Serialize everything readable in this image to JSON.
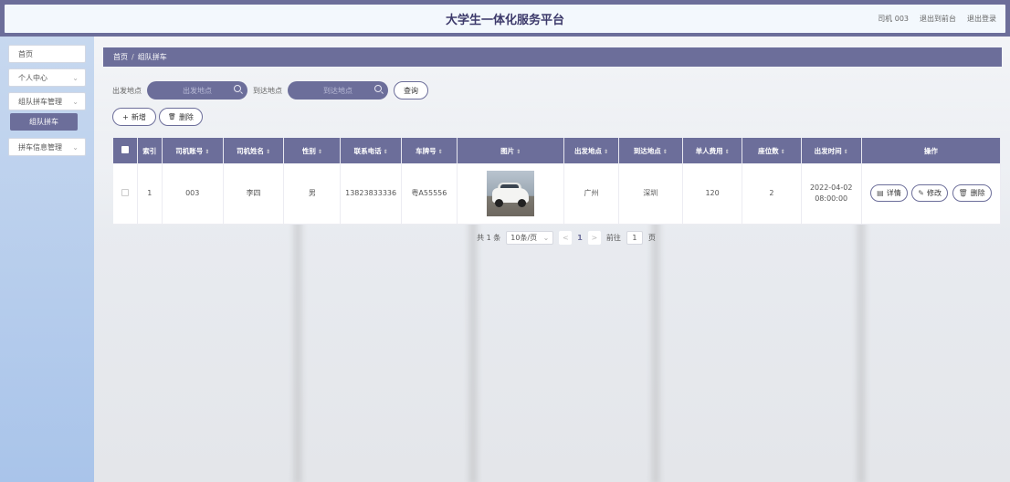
{
  "app": {
    "title": "大学生一体化服务平台"
  },
  "header": {
    "user": "司机 003",
    "go_front": "退出到前台",
    "logout": "退出登录"
  },
  "sidebar": {
    "items": [
      {
        "label": "首页",
        "has_chevron": false
      },
      {
        "label": "个人中心",
        "has_chevron": true
      },
      {
        "label": "组队拼车管理",
        "has_chevron": true
      },
      {
        "label": "拼车信息管理",
        "has_chevron": true
      }
    ],
    "active_sub": "组队拼车",
    "chevron": "⌄"
  },
  "breadcrumb": {
    "home": "首页",
    "sep": "/",
    "current": "组队拼车"
  },
  "search": {
    "origin_label": "出发地点",
    "origin_placeholder": "出发地点",
    "dest_label": "到达地点",
    "dest_placeholder": "到达地点",
    "query_button": "查询"
  },
  "actions": {
    "add": "新增",
    "delete": "删除",
    "add_icon": "+",
    "delete_icon": "🗑"
  },
  "table": {
    "columns": [
      "索引",
      "司机账号",
      "司机姓名",
      "性别",
      "联系电话",
      "车牌号",
      "图片",
      "出发地点",
      "到达地点",
      "单人费用",
      "座位数",
      "出发时间",
      "操作"
    ],
    "sort_glyph": "⇕",
    "rows": [
      {
        "index": "1",
        "driver_account": "003",
        "driver_name": "李四",
        "gender": "男",
        "phone": "13823833336",
        "plate": "粤A55556",
        "image": "white-suv-photo",
        "origin": "广州",
        "destination": "深圳",
        "fee": "120",
        "seats": "2",
        "depart_time": "2022-04-02 08:00:00"
      }
    ],
    "ops": {
      "detail": "详情",
      "edit": "修改",
      "delete": "删除"
    }
  },
  "pagination": {
    "total": "共 1 条",
    "page_size": "10条/页",
    "prev": "<",
    "current_page": "1",
    "next": ">",
    "goto_label": "前往",
    "goto_value": "1",
    "page_unit": "页"
  },
  "colors": {
    "primary": "#6c6e9a",
    "header_bg": "#f3f8fd",
    "sidebar_bg": "#b8cfee"
  }
}
